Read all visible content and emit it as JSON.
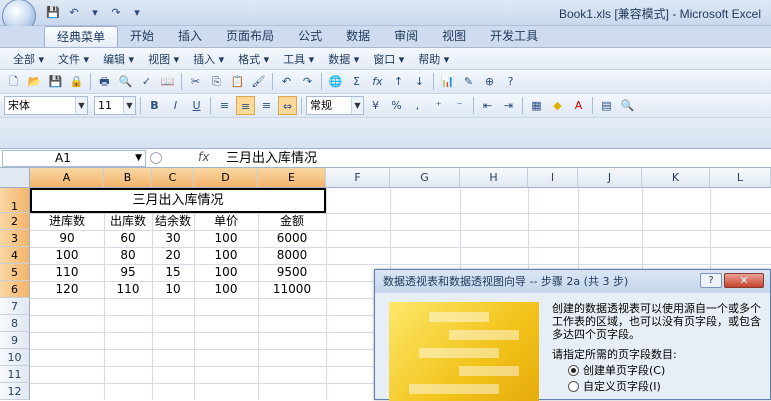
{
  "window": {
    "title": "Book1.xls  [兼容模式] - Microsoft Excel"
  },
  "ribbon_tabs": [
    "经典菜单",
    "开始",
    "插入",
    "页面布局",
    "公式",
    "数据",
    "审阅",
    "视图",
    "开发工具"
  ],
  "menu": [
    "全部 ▾",
    "文件 ▾",
    "编辑 ▾",
    "视图 ▾",
    "插入 ▾",
    "格式 ▾",
    "工具 ▾",
    "数据 ▾",
    "窗口 ▾",
    "帮助 ▾"
  ],
  "format_bar": {
    "font": "宋体",
    "size": "11",
    "bold": "B",
    "italic": "I",
    "underline": "U",
    "style": "常规"
  },
  "formula_bar": {
    "name_box": "A1",
    "fx": "fx",
    "formula": "三月出入库情况"
  },
  "sheet": {
    "columns": [
      "A",
      "B",
      "C",
      "D",
      "E",
      "F",
      "G",
      "H",
      "I",
      "J",
      "K",
      "L"
    ],
    "rows": [
      "1",
      "2",
      "3",
      "4",
      "5",
      "6",
      "7",
      "8",
      "9",
      "10",
      "11",
      "12"
    ],
    "merged_title": "三月出入库情况",
    "headers": [
      "进库数",
      "出库数",
      "结余数",
      "单价",
      "金额"
    ],
    "data": [
      [
        "90",
        "60",
        "30",
        "100",
        "6000"
      ],
      [
        "100",
        "80",
        "20",
        "100",
        "8000"
      ],
      [
        "110",
        "95",
        "15",
        "100",
        "9500"
      ],
      [
        "120",
        "110",
        "10",
        "100",
        "11000"
      ]
    ]
  },
  "dialog": {
    "title": "数据透视表和数据透视图向导 -- 步骤 2a (共 3 步)",
    "help": "?",
    "close": "✕",
    "description": "创建的数据透视表可以使用源自一个或多个工作表的区域，也可以没有页字段，或包含多达四个页字段。",
    "prompt": "请指定所需的页字段数目:",
    "option1": "创建单页字段(C)",
    "option2": "自定义页字段(I)"
  },
  "colors": {
    "selected_header": "#f4b46a",
    "ribbon": "#cfdcef"
  }
}
